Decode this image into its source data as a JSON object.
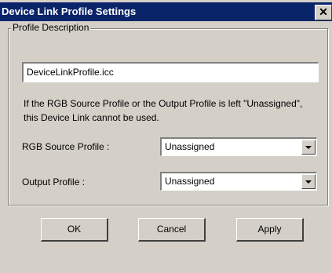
{
  "window": {
    "title": "Device Link Profile Settings",
    "close_glyph": "✕"
  },
  "profile_group": {
    "legend": "Profile Description",
    "description_value": "DeviceLinkProfile.icc",
    "note": "If the RGB Source Profile or the Output Profile is left \"Unassigned\", this Device Link cannot be used."
  },
  "rgb_source": {
    "label": "RGB Source Profile :",
    "selected": "Unassigned"
  },
  "output_profile": {
    "label": "Output Profile :",
    "selected": "Unassigned"
  },
  "buttons": {
    "ok": "OK",
    "cancel": "Cancel",
    "apply": "Apply"
  },
  "colors": {
    "titlebar": "#0a246a",
    "face": "#d4d0c8"
  }
}
